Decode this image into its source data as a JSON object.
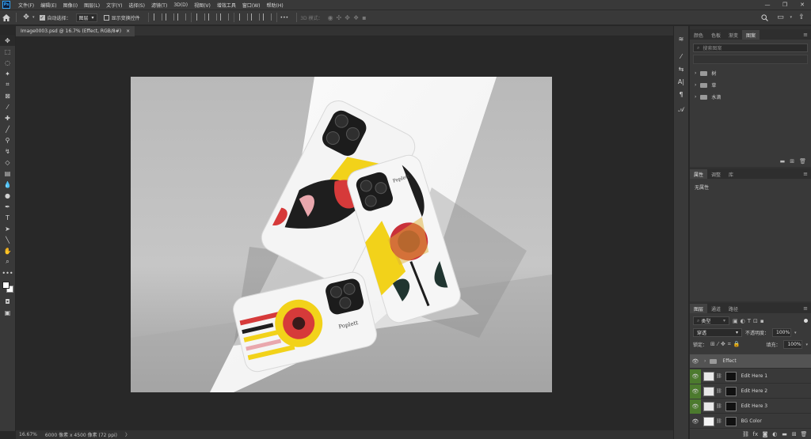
{
  "menubar": {
    "app_logo": "Ps",
    "items": [
      "文件(F)",
      "编辑(E)",
      "图像(I)",
      "图层(L)",
      "文字(Y)",
      "选择(S)",
      "滤镜(T)",
      "3D(D)",
      "视图(V)",
      "增效工具",
      "窗口(W)",
      "帮助(H)"
    ],
    "window_buttons": [
      "—",
      "❐",
      "✕"
    ]
  },
  "options": {
    "auto_select_label": "自动选择：",
    "auto_select_value": "图层",
    "show_transform_label": "显示变换控件",
    "mode_label": "3D 模式：",
    "more": "•••"
  },
  "tab": {
    "title": "Image0003.psd @ 16.7% (Effect, RGB/8#)",
    "close": "×"
  },
  "status": {
    "zoom": "16.67%",
    "size": "6000 像素 x 4500 像素 (72 ppi)",
    "arrow": "〉"
  },
  "panels": {
    "top_tabs": [
      "颜色",
      "色板",
      "渐变",
      "图案"
    ],
    "top_active": 3,
    "search_placeholder": "搜索图案",
    "library": [
      "树",
      "草",
      "水滴"
    ],
    "props_tabs": [
      "属性",
      "调整",
      "库"
    ],
    "props_active": 0,
    "props_empty": "无属性",
    "layers_tabs": [
      "图层",
      "通道",
      "路径"
    ],
    "layers_active": 0,
    "filter_label": "类型",
    "blend_mode": "穿透",
    "opacity_label": "不透明度：",
    "opacity_value": "100%",
    "lock_label": "锁定：",
    "fill_label": "填充：",
    "fill_value": "100%",
    "layers": [
      {
        "name": "Effect",
        "type": "group"
      },
      {
        "name": "Edit Here 1",
        "type": "smart"
      },
      {
        "name": "Edit Here 2",
        "type": "smart"
      },
      {
        "name": "Edit Here 3",
        "type": "smart"
      },
      {
        "name": "BG Color",
        "type": "fill"
      }
    ],
    "brand_text": "Poplett"
  },
  "colors": {
    "accent_yellow": "#f2d21a",
    "accent_red": "#d63a3a",
    "layer_selected": "#4c7a2e"
  }
}
